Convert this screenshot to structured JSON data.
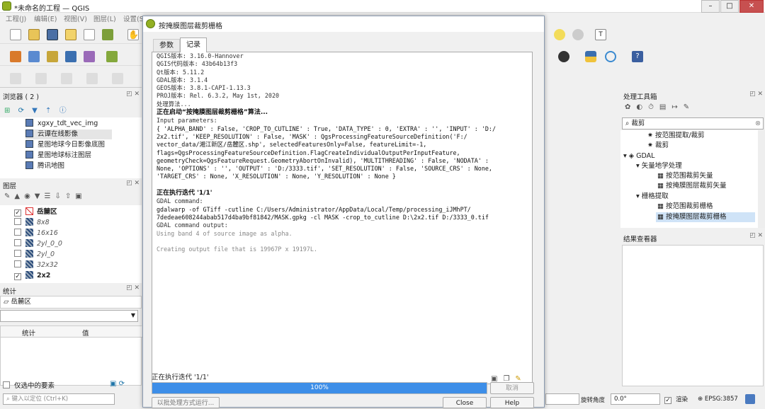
{
  "app": {
    "title": "*未命名的工程 — QGIS",
    "menu": [
      "工程(J)",
      "编辑(E)",
      "视图(V)",
      "图层(L)",
      "设置(S)"
    ],
    "window_controls": [
      "–",
      "□",
      "✕"
    ]
  },
  "browser": {
    "title": "浏览器 ( 2 )",
    "items": [
      "xgxy_tdt_vec_img",
      "云谭在线影像",
      "星图地球今日影像底图",
      "星图地球标注图层",
      "腾讯地图"
    ]
  },
  "layers": {
    "title": "图层",
    "items": [
      {
        "name": "岳麓区",
        "checked": true,
        "bold": true,
        "italic": false
      },
      {
        "name": "8x8",
        "checked": false,
        "bold": false,
        "italic": true
      },
      {
        "name": "16x16",
        "checked": false,
        "bold": false,
        "italic": true
      },
      {
        "name": "2yl_0_0",
        "checked": false,
        "bold": false,
        "italic": true
      },
      {
        "name": "2yl_0",
        "checked": false,
        "bold": false,
        "italic": true
      },
      {
        "name": "32x32",
        "checked": false,
        "bold": false,
        "italic": true
      },
      {
        "name": "2x2",
        "checked": true,
        "bold": true,
        "italic": false
      }
    ]
  },
  "stats": {
    "title": "统计",
    "layer": "岳麓区",
    "col_stat": "统计",
    "col_value": "值",
    "selected_only": "仅选中的要素"
  },
  "locator": {
    "placeholder": "键入以定位 (Ctrl+K)"
  },
  "dialog": {
    "title": "按掩膜图层裁剪栅格",
    "tabs": [
      "参数",
      "记录"
    ],
    "active_tab": "记录",
    "log": {
      "version_lines": [
        "QGIS版本: 3.16.0-Hannover",
        "QGIS代码版本: 43b64b13f3",
        "Qt版本: 5.11.2",
        "GDAL版本: 3.1.4",
        "GEOS版本: 3.8.1-CAPI-1.13.3",
        "PROJ版本: Rel. 6.3.2, May 1st, 2020"
      ],
      "processing": "处理算法...",
      "starting": "正在启动“按掩膜图层裁剪栅格”算法...",
      "input_params_label": "Input parameters:",
      "params_lines": [
        "{ 'ALPHA_BAND' : False, 'CROP_TO_CUTLINE' : True, 'DATA_TYPE' : 0, 'EXTRA' : '', 'INPUT' : 'D:/",
        "2x2.tif', 'KEEP_RESOLUTION' : False, 'MASK' : QgsProcessingFeatureSourceDefinition('F:/",
        "vector_data/湘江新区/岳麓区.shp', selectedFeaturesOnly=False, featureLimit=-1,",
        "flags=QgsProcessingFeatureSourceDefinition.FlagCreateIndividualOutputPerInputFeature,",
        "geometryCheck=QgsFeatureRequest.GeometryAbortOnInvalid), 'MULTITHREADING' : False, 'NODATA' :",
        "None, 'OPTIONS' : '', 'OUTPUT' : 'D:/3333.tif', 'SET_RESOLUTION' : False, 'SOURCE_CRS' : None,",
        "'TARGET_CRS' : None, 'X_RESOLUTION' : None, 'Y_RESOLUTION' : None }"
      ],
      "iteration": "正在执行迭代 '1/1'",
      "gdal_cmd_label": "GDAL command:",
      "gdal_cmd_lines": [
        "gdalwarp -of GTiff -cutline C:/Users/Administrator/AppData/Local/Temp/processing_iJMhPT/",
        "7dedeae608244abab517d4ba9bf81842/MASK.gpkg -cl MASK -crop_to_cutline D:\\2x2.tif D:/3333_0.tif"
      ],
      "gdal_output_label": "GDAL command output:",
      "output_lines": [
        "Using band 4 of source image as alpha.",
        "",
        "Creating output file that is 19967P x 19197L."
      ]
    },
    "status": "正在执行迭代 '1/1'",
    "progress_text": "100%",
    "progress": 1.0,
    "cancel": "取消",
    "batch": "以批处理方式运行...",
    "close": "Close",
    "help": "Help"
  },
  "toolbox": {
    "title": "处理工具箱",
    "search": "裁剪",
    "items": [
      "按范围提取/裁剪",
      "裁剪",
      "GDAL",
      "矢量地学处理",
      "按范围裁剪矢量",
      "按掩膜图层裁剪矢量",
      "栅格提取",
      "按范围裁剪栅格",
      "按掩膜图层裁剪栅格"
    ]
  },
  "results": {
    "title": "结果查看器"
  },
  "statusbar": {
    "rotation_label": "旋转角度",
    "rotation_value": "0.0°",
    "render_label": "渲染",
    "crs": "EPSG:3857"
  },
  "colors": {
    "accent": "#3d8ee8",
    "progress": "#3d8ee8"
  }
}
